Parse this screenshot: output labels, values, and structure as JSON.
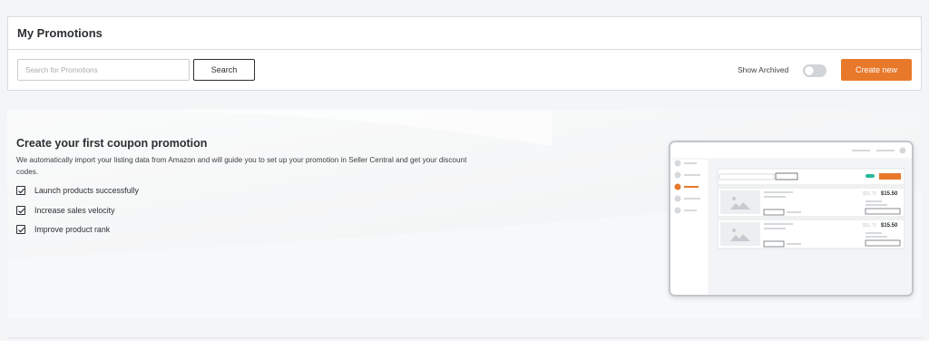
{
  "header": {
    "title": "My Promotions"
  },
  "toolbar": {
    "search_placeholder": "Search for Promotions",
    "search_value": "",
    "search_label": "Search",
    "show_archived_label": "Show Archived",
    "show_archived_on": false,
    "create_label": "Create new",
    "accent_color": "#e8792b"
  },
  "promo": {
    "title": "Create your first coupon promotion",
    "description": "We automatically import your listing data from Amazon and will guide you to set up your promotion in Seller Central and get your discount codes.",
    "benefits": [
      {
        "label": "Launch products successfully",
        "checked": true,
        "icon": "checkbox-checked-icon"
      },
      {
        "label": "Increase sales velocity",
        "checked": true,
        "icon": "checkbox-checked-icon"
      },
      {
        "label": "Improve product rank",
        "checked": true,
        "icon": "checkbox-checked-icon"
      }
    ],
    "illustration": {
      "items": [
        {
          "old_price": "$91.75",
          "new_price": "$15.50"
        },
        {
          "old_price": "$91.75",
          "new_price": "$15.50"
        }
      ]
    }
  }
}
